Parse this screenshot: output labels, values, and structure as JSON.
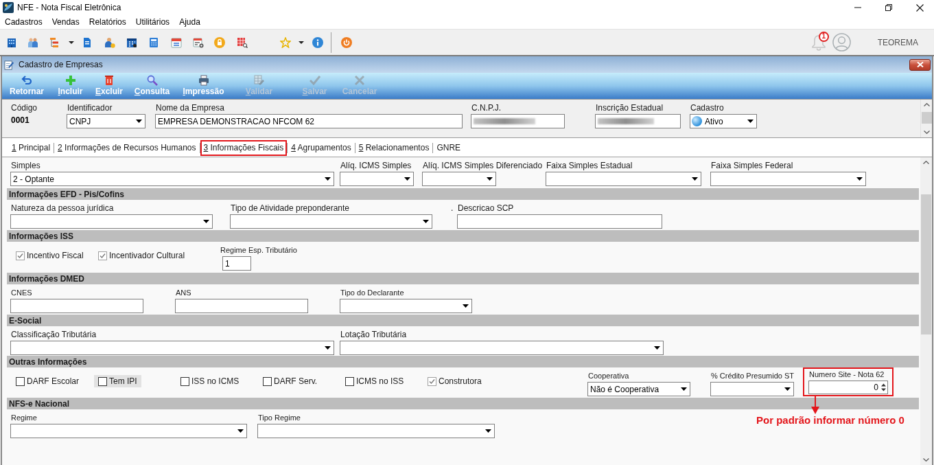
{
  "window": {
    "title": "NFE - Nota Fiscal Eletrônica"
  },
  "menu": [
    "Cadastros",
    "Vendas",
    "Relatórios",
    "Utilitários",
    "Ajuda"
  ],
  "toolbar": {
    "notification_count": "1",
    "user": "TEOREMA"
  },
  "child_window": {
    "title": "Cadastro de Empresas"
  },
  "commands": [
    {
      "label": "Retornar",
      "mnemonic": false,
      "disabled": false
    },
    {
      "label": "Incluir",
      "mnemonic": true,
      "disabled": false
    },
    {
      "label": "Excluir",
      "mnemonic": true,
      "disabled": false
    },
    {
      "label": "Consulta",
      "mnemonic": true,
      "disabled": false
    },
    {
      "label": "Impressão",
      "mnemonic": true,
      "disabled": false
    },
    {
      "label": "Validar",
      "mnemonic": true,
      "disabled": true
    },
    {
      "label": "Salvar",
      "mnemonic": true,
      "disabled": true
    },
    {
      "label": "Cancelar",
      "mnemonic": false,
      "disabled": true
    }
  ],
  "header": {
    "fields": [
      {
        "kind": "static",
        "label": "Código",
        "value": "0001",
        "redacted": false
      },
      {
        "kind": "select",
        "label": "Identificador",
        "value": "CNPJ",
        "redacted": false
      },
      {
        "kind": "input",
        "label": "Nome da Empresa",
        "value": "EMPRESA DEMONSTRACAO NFCOM 62",
        "redacted": false
      },
      {
        "kind": "input",
        "label": "C.N.P.J.",
        "redacted": true
      },
      {
        "kind": "input",
        "label": "Inscrição Estadual",
        "redacted": true
      },
      {
        "kind": "status_select",
        "label": "Cadastro",
        "value": "Ativo",
        "redacted": false
      }
    ]
  },
  "tabs": [
    {
      "label": "1 Principal",
      "mnemonic": true,
      "selected": false
    },
    {
      "label": "2 Informações de Recursos Humanos",
      "mnemonic": true,
      "selected": false
    },
    {
      "label": "3 Informações Fiscais",
      "mnemonic": true,
      "selected": true
    },
    {
      "label": "4 Agrupamentos",
      "mnemonic": true,
      "selected": false
    },
    {
      "label": "5 Relacionamentos",
      "mnemonic": true,
      "selected": false
    },
    {
      "label": "GNRE",
      "mnemonic": false,
      "selected": false
    }
  ],
  "sections": [
    {
      "items": [
        {
          "kind": "select",
          "label": "Simples",
          "value": "2 - Optante"
        },
        {
          "kind": "select",
          "label": "Alíq. ICMS Simples"
        },
        {
          "kind": "select",
          "label": "Alíq. ICMS Simples Diferenciado"
        },
        {
          "kind": "select",
          "label": "Faixa Simples Estadual"
        },
        {
          "kind": "select",
          "label": "Faixa Simples Federal"
        }
      ]
    },
    {
      "title": "Informações EFD - Pis/Cofins",
      "items": [
        {
          "kind": "select",
          "label": "Natureza da pessoa jurídica"
        },
        {
          "kind": "select",
          "label": "Tipo de Atividade preponderante"
        },
        {
          "kind": "text",
          "label": "."
        },
        {
          "kind": "input",
          "label": "Descricao SCP"
        }
      ]
    },
    {
      "title": "Informações ISS",
      "items": [
        {
          "kind": "checkbox",
          "label": "Incentivo Fiscal",
          "checked": true,
          "focused": false
        },
        {
          "kind": "checkbox",
          "label": "Incentivador Cultural",
          "checked": true,
          "focused": false
        },
        {
          "kind": "input",
          "label": "Regime Esp. Tributário",
          "value": "1"
        }
      ]
    },
    {
      "title": "Informações DMED",
      "items": [
        {
          "kind": "input",
          "label": "CNES"
        },
        {
          "kind": "input",
          "label": "ANS"
        },
        {
          "kind": "select",
          "label": "Tipo do Declarante"
        }
      ]
    },
    {
      "title": "E-Social",
      "items": [
        {
          "kind": "select",
          "label": "Classificação Tributária"
        },
        {
          "kind": "select",
          "label": "Lotação Tributária"
        }
      ]
    },
    {
      "title": "Outras Informações",
      "items": [
        {
          "kind": "checkbox",
          "label": "DARF Escolar",
          "checked": false,
          "focused": false,
          "highlighted": false
        },
        {
          "kind": "checkbox",
          "label": "Tem IPI",
          "checked": false,
          "focused": true,
          "highlighted": false
        },
        {
          "kind": "checkbox",
          "label": "ISS no ICMS",
          "checked": false,
          "focused": false,
          "highlighted": false
        },
        {
          "kind": "checkbox",
          "label": "DARF Serv.",
          "checked": false,
          "focused": false,
          "highlighted": false
        },
        {
          "kind": "checkbox",
          "label": "ICMS no ISS",
          "checked": false,
          "focused": false,
          "highlighted": false
        },
        {
          "kind": "checkbox",
          "label": "Construtora",
          "checked": true,
          "focused": false,
          "highlighted": false
        },
        {
          "kind": "select",
          "label": "Cooperativa",
          "value": "Não é Cooperativa",
          "highlighted": false
        },
        {
          "kind": "select",
          "label": "% Crédito Presumido ST",
          "highlighted": false
        },
        {
          "kind": "spinner",
          "label": "Numero Site - Nota 62",
          "value": "0",
          "highlighted": true,
          "callout": "Por padrão informar número 0"
        }
      ]
    },
    {
      "title": "NFS-e Nacional",
      "items": [
        {
          "kind": "select",
          "label": "Regime"
        },
        {
          "kind": "select",
          "label": "Tipo Regime"
        }
      ]
    }
  ]
}
